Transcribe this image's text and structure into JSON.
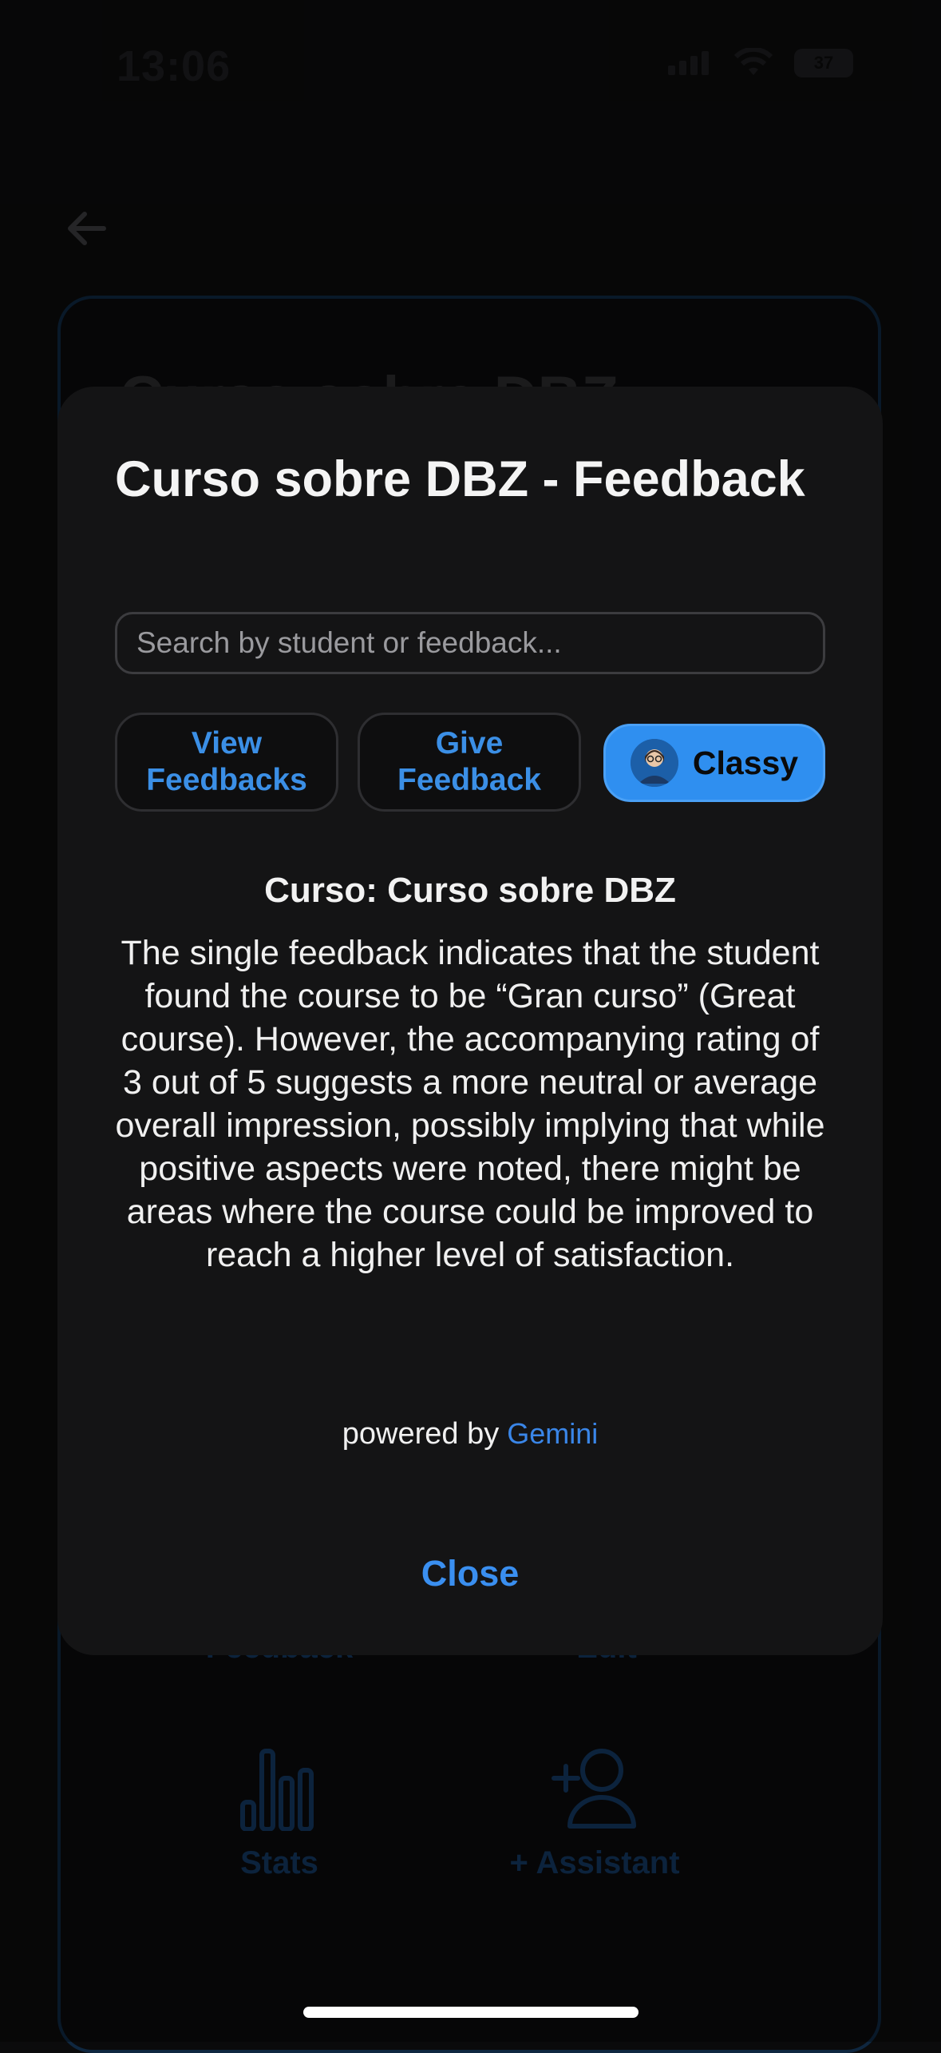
{
  "status_bar": {
    "time": "13:06",
    "battery": "37"
  },
  "background": {
    "title": "Curso sobre DBZ",
    "tiles": [
      {
        "label": "Feedback"
      },
      {
        "label": "Edit"
      },
      {
        "label": "Stats"
      },
      {
        "label": "+ Assistant"
      }
    ]
  },
  "modal": {
    "title": "Curso sobre DBZ - Feedback",
    "search_placeholder": "Search by student or feedback...",
    "buttons": {
      "view_feedbacks": "View Feedbacks",
      "give_feedback": "Give Feedback",
      "classy": "Classy"
    },
    "summary_title": "Curso: Curso sobre DBZ",
    "summary_text": "The single feedback indicates that the student found the course to be “Gran curso” (Great course). However, the accompanying rating of 3 out of 5 suggests a more neutral or average overall impression, possibly implying that while positive aspects were noted, there might be areas where the course could be improved to reach a higher level of satisfaction.",
    "powered_by": "powered by",
    "powered_brand": "Gemini",
    "close_label": "Close"
  },
  "colors": {
    "accent": "#2f8ff0",
    "modal_bg": "#141415",
    "page_bg": "#0b0b0c"
  },
  "icons": [
    "back-arrow-icon",
    "stats-icon",
    "add-person-icon",
    "avatar-icon",
    "signal-icon",
    "wifi-icon",
    "battery-icon"
  ]
}
